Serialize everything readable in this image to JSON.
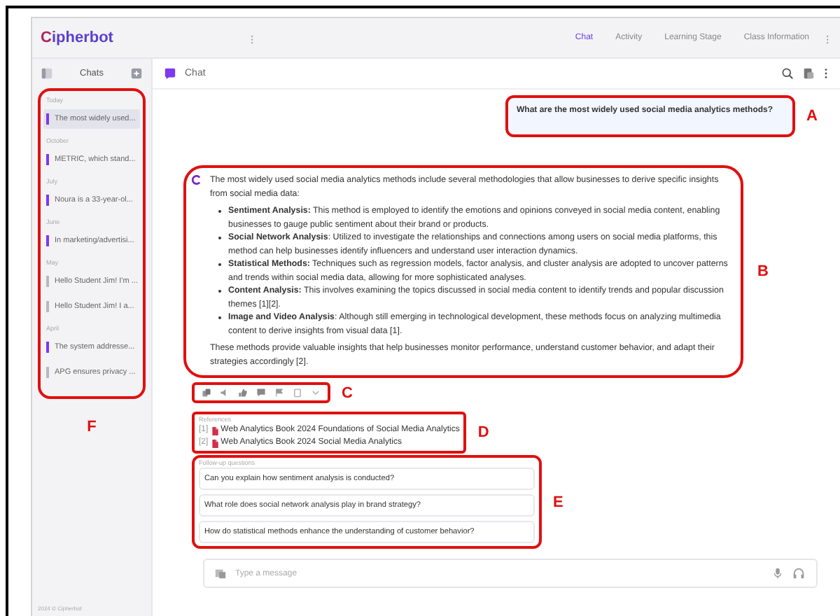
{
  "header": {
    "logo": "Cipherbot",
    "separator": "⁝",
    "tabs": [
      {
        "label": "Chat",
        "selected": true
      },
      {
        "label": "Activity",
        "selected": false
      },
      {
        "label": "Learning Stage",
        "selected": false
      },
      {
        "label": "Class Information",
        "selected": false
      }
    ],
    "more": "⁝"
  },
  "sidebar": {
    "title": "Chats",
    "annotation": "F",
    "groups": [
      {
        "label": "Today",
        "items": [
          {
            "text": "The most widely used...",
            "selected": true,
            "color": "#7c3aed"
          }
        ]
      },
      {
        "label": "October",
        "items": [
          {
            "text": "METRIC, which stand...",
            "selected": false,
            "color": "#7c3aed"
          }
        ]
      },
      {
        "label": "July",
        "items": [
          {
            "text": "Noura is a 33-year-ol...",
            "selected": false,
            "color": "#7c3aed"
          }
        ]
      },
      {
        "label": "June",
        "items": [
          {
            "text": "In marketing/advertisi...",
            "selected": false,
            "color": "#7c3aed"
          }
        ]
      },
      {
        "label": "May",
        "items": [
          {
            "text": "Hello Student Jim! I'm ...",
            "selected": false,
            "color": "#b8b8c0"
          },
          {
            "text": "Hello Student Jim! I a...",
            "selected": false,
            "color": "#b8b8c0"
          }
        ]
      },
      {
        "label": "April",
        "items": [
          {
            "text": "The system addresse...",
            "selected": false,
            "color": "#7c3aed"
          },
          {
            "text": "APG ensures privacy ...",
            "selected": false,
            "color": "#b8b8c0"
          }
        ]
      }
    ],
    "footer": "2024 © Cipherbot"
  },
  "chat": {
    "title": "Chat",
    "question": {
      "text": "What are the most widely used social media analytics methods?",
      "annotation": "A"
    },
    "answer": {
      "annotation": "B",
      "intro": "The most widely used social media analytics methods include several methodologies that allow businesses to derive specific insights from social media data:",
      "bullets": [
        "**Sentiment Analysis:** This method is employed to identify the emotions and opinions conveyed in social media content, enabling businesses to gauge public sentiment about their brand or products.",
        "**Social Network Analysis**: Utilized to investigate the relationships and connections among users on social media platforms, this method can help businesses identify influencers and understand user interaction dynamics.",
        "**Statistical Methods:** Techniques such as regression models, factor analysis, and cluster analysis are adopted to uncover patterns and trends within social media data, allowing for more sophisticated analyses.",
        "**Content Analysis:** This involves examining the topics discussed in social media content to identify trends and popular discussion themes [1][2].",
        "**Image and Video Analysis**: Although still emerging in technological development, these methods focus on analyzing multimedia content to derive insights from visual data [1]."
      ],
      "outro": "These methods provide valuable insights that help businesses monitor performance, understand customer behavior, and adapt their strategies accordingly [2]."
    },
    "actions": {
      "annotation": "C"
    },
    "references": {
      "annotation": "D",
      "title": "References",
      "items": [
        {
          "number": "[1]",
          "title": "Web Analytics Book 2024 Foundations of Social Media Analytics"
        },
        {
          "number": "[2]",
          "title": "Web Analytics Book 2024 Social Media Analytics"
        }
      ]
    },
    "followups": {
      "annotation": "E",
      "title": "Follow-up questions",
      "items": [
        "Can you explain how sentiment analysis is conducted?",
        "What role does social network analysis play in brand strategy?",
        "How do statistical methods enhance the understanding of customer behavior?"
      ]
    },
    "input": {
      "placeholder": "Type a message"
    }
  }
}
